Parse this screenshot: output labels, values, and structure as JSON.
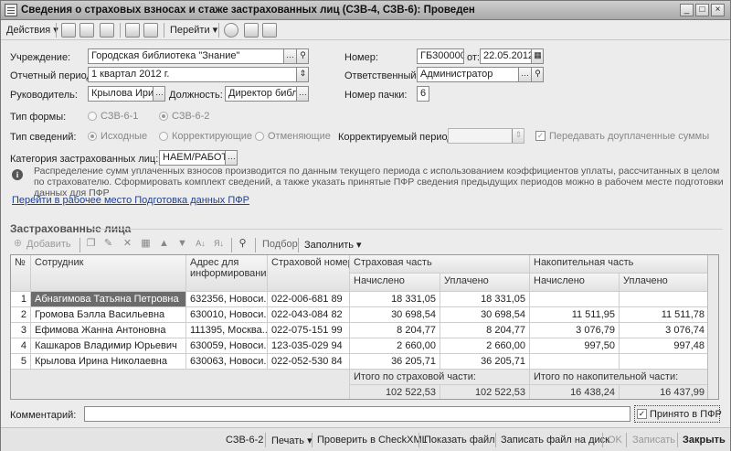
{
  "window": {
    "title": "Сведения о страховых взносах и стаже застрахованных лиц (СЗВ-4, СЗВ-6): Проведен",
    "minimize": "_",
    "maximize": "□",
    "close": "×"
  },
  "toolbar": {
    "actions": "Действия ▾",
    "goto": "Перейти ▾"
  },
  "form": {
    "institution_label": "Учреждение:",
    "institution_value": "Городская библиотека \"Знание\"",
    "period_label": "Отчетный период:",
    "period_value": "1 квартал 2012 г.",
    "head_label": "Руководитель:",
    "head_value": "Крылова Ирин",
    "position_label": "Должность:",
    "position_value": "Директор библи",
    "number_label": "Номер:",
    "number_value": "ГБ300000",
    "from_label": "от:",
    "date_value": "22.05.2012",
    "responsible_label": "Ответственный:",
    "responsible_value": "Администратор",
    "pack_label": "Номер пачки:",
    "pack_value": "6",
    "form_type_label": "Тип формы:",
    "form_type_opt1": "СЗВ-6-1",
    "form_type_opt2": "СЗВ-6-2",
    "info_type_label": "Тип сведений:",
    "info_type_opt1": "Исходные",
    "info_type_opt2": "Корректирующие",
    "info_type_opt3": "Отменяющие",
    "corr_period_label": "Корректируемый период:",
    "corr_period_value": "",
    "extra_sums_label": "Передавать доуплаченные суммы",
    "category_label": "Категория застрахованных лиц:",
    "category_value": "НАЕМ/РАБОТІ",
    "info_text": "Распределение сумм уплаченных взносов производится по данным текущего периода с использованием коэффициентов уплаты, рассчитанных в целом по страхователю. Сформировать комплект сведений, а также указать принятые ПФР сведения предыдущих периодов можно в рабочем месте подготовки данных для ПФР",
    "workplace_link": "Перейти в рабочее место Подготовка данных ПФР"
  },
  "section": {
    "title": "Застрахованные лица"
  },
  "table_toolbar": {
    "add": "Добавить",
    "select": "Подбор",
    "fill": "Заполнить ▾"
  },
  "table": {
    "headers": {
      "no": "№",
      "employee": "Сотрудник",
      "address": "Адрес для информирования",
      "insurance_number": "Страховой номер",
      "insurance_part": "Страховая часть",
      "savings_part": "Накопительная часть",
      "accrued": "Начислено",
      "paid": "Уплачено"
    },
    "rows": [
      {
        "no": "1",
        "employee": "Абнагимова Татьяна Петровна",
        "address": "632356, Новоси...",
        "snils": "022-006-681 89",
        "ins_acc": "18 331,05",
        "ins_paid": "18 331,05",
        "sav_acc": "",
        "sav_paid": ""
      },
      {
        "no": "2",
        "employee": "Громова Бэлла Васильевна",
        "address": "630010, Новоси...",
        "snils": "022-043-084 82",
        "ins_acc": "30 698,54",
        "ins_paid": "30 698,54",
        "sav_acc": "11 511,95",
        "sav_paid": "11 511,78"
      },
      {
        "no": "3",
        "employee": "Ефимова Жанна Антоновна",
        "address": "111395, Москва...",
        "snils": "022-075-151 99",
        "ins_acc": "8 204,77",
        "ins_paid": "8 204,77",
        "sav_acc": "3 076,79",
        "sav_paid": "3 076,74"
      },
      {
        "no": "4",
        "employee": "Кашкаров Владимир Юрьевич",
        "address": "630059, Новоси...",
        "snils": "123-035-029 94",
        "ins_acc": "2 660,00",
        "ins_paid": "2 660,00",
        "sav_acc": "997,50",
        "sav_paid": "997,48"
      },
      {
        "no": "5",
        "employee": "Крылова Ирина Николаевна",
        "address": "630063, Новоси...",
        "snils": "022-052-530 84",
        "ins_acc": "36 205,71",
        "ins_paid": "36 205,71",
        "sav_acc": "",
        "sav_paid": ""
      }
    ],
    "totals": {
      "ins_label": "Итого по страховой части:",
      "sav_label": "Итого по накопительной части:",
      "ins_acc": "102 522,53",
      "ins_paid": "102 522,53",
      "sav_acc": "16 438,24",
      "sav_paid": "16 437,99"
    }
  },
  "comment": {
    "label": "Комментарий:",
    "value": "",
    "accepted_label": "Принято в ПФР"
  },
  "bottom": {
    "form_name": "СЗВ-6-2",
    "print": "Печать ▾",
    "check": "Проверить в CheckXML",
    "show_file": "Показать файл",
    "write_file": "Записать файл на диск",
    "ok": "OK",
    "save": "Записать",
    "close": "Закрыть"
  }
}
